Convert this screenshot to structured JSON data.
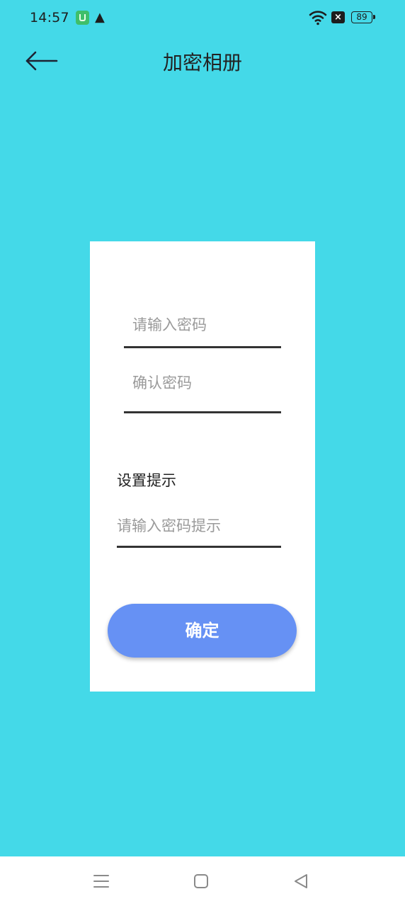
{
  "status_bar": {
    "time": "14:57",
    "battery": "89",
    "notification_close_glyph": "×",
    "warning_glyph": "▲",
    "icons": [
      "app-notification-icon",
      "warning-icon",
      "wifi-icon",
      "notification-close-icon",
      "battery-icon"
    ]
  },
  "header": {
    "title": "加密相册",
    "back_icon": "back-arrow-icon"
  },
  "form": {
    "password_placeholder": "请输入密码",
    "confirm_placeholder": "确认密码",
    "hint_label": "设置提示",
    "hint_placeholder": "请输入密码提示",
    "confirm_button": "确定"
  },
  "nav_bar": {
    "icons": [
      "menu-icon",
      "home-icon",
      "back-icon"
    ]
  },
  "colors": {
    "background": "#44d9e8",
    "card": "#ffffff",
    "button": "#6691f4",
    "underline": "#333333",
    "placeholder": "#9a9a9a"
  }
}
